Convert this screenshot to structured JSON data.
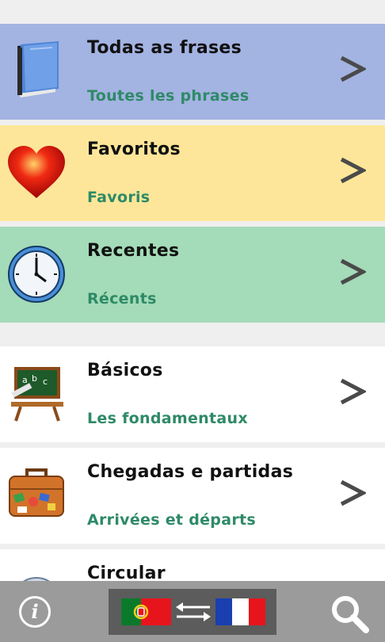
{
  "items": [
    {
      "title": "Todas as frases",
      "subtitle": "Toutes les phrases",
      "bg": "#a3b3e2",
      "icon": "book-icon"
    },
    {
      "title": "Favoritos",
      "subtitle": "Favoris",
      "bg": "#fde699",
      "icon": "heart-icon"
    },
    {
      "title": "Recentes",
      "subtitle": "Récents",
      "bg": "#a4dbb8",
      "icon": "clock-icon"
    },
    {
      "title": "Básicos",
      "subtitle": "Les fondamentaux",
      "bg": "#ffffff",
      "icon": "chalkboard-icon"
    },
    {
      "title": "Chegadas e partidas",
      "subtitle": "Arrivées et départs",
      "bg": "#ffffff",
      "icon": "suitcase-icon"
    },
    {
      "title": "Circular",
      "subtitle": "",
      "bg": "#ffffff",
      "icon": "compass-icon"
    }
  ],
  "chevron": ">",
  "bottom_bar": {
    "info_label": "i",
    "source_flag": "portugal-flag-icon",
    "swap_icon": "swap-arrows-icon",
    "target_flag": "france-flag-icon",
    "search_icon": "search-icon"
  }
}
